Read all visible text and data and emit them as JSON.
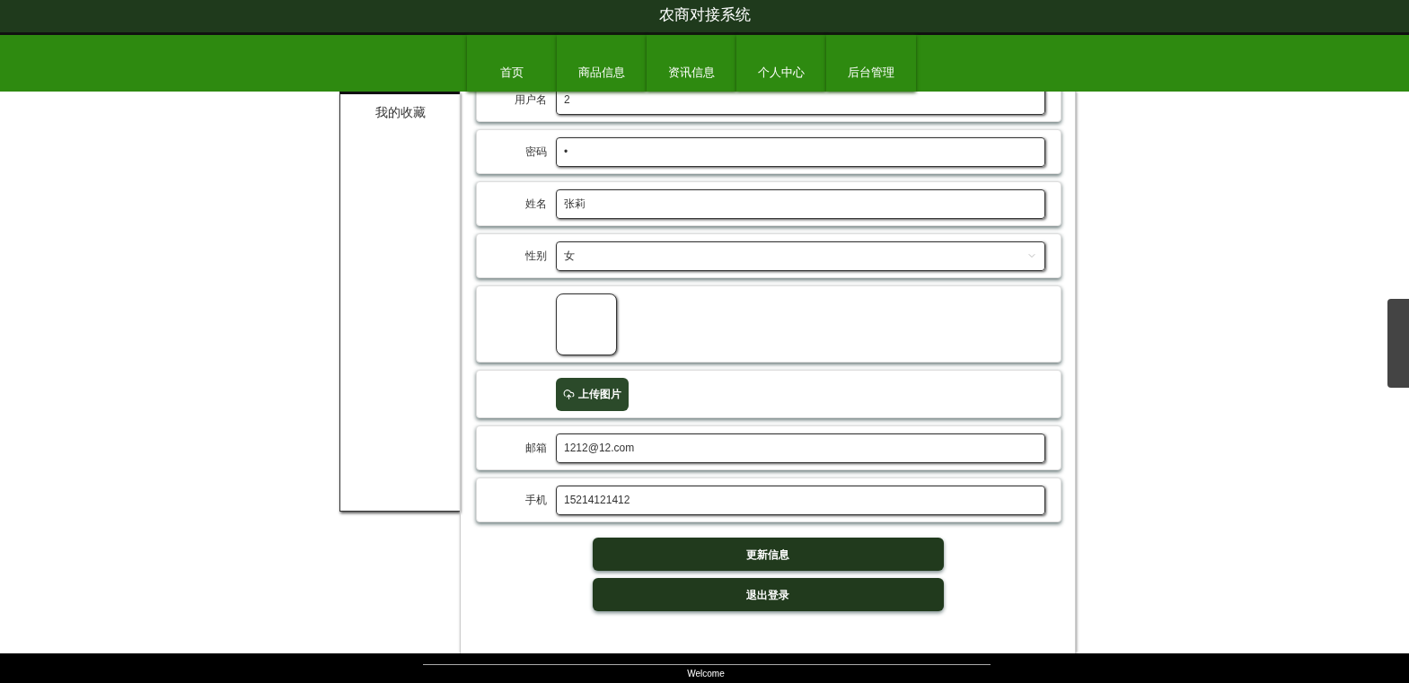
{
  "header": {
    "title": "农商对接系统"
  },
  "nav": [
    "首页",
    "商品信息",
    "资讯信息",
    "个人中心",
    "后台管理"
  ],
  "sidebar": {
    "items": [
      "我的收藏"
    ]
  },
  "form": {
    "fields": [
      {
        "kind": "text",
        "label": "用户名",
        "value": "2"
      },
      {
        "kind": "text",
        "label": "密码",
        "value": "•"
      },
      {
        "kind": "text",
        "label": "姓名",
        "value": "张莉"
      },
      {
        "kind": "select",
        "label": "性别",
        "value": "女"
      },
      {
        "kind": "image"
      },
      {
        "kind": "upload",
        "button": "上传图片"
      },
      {
        "kind": "text",
        "label": "邮箱",
        "value": "1212@12.com"
      },
      {
        "kind": "text",
        "label": "手机",
        "value": "15214121412"
      }
    ],
    "buttons": [
      "更新信息",
      "退出登录"
    ]
  },
  "footer": {
    "text": "Welcome"
  }
}
